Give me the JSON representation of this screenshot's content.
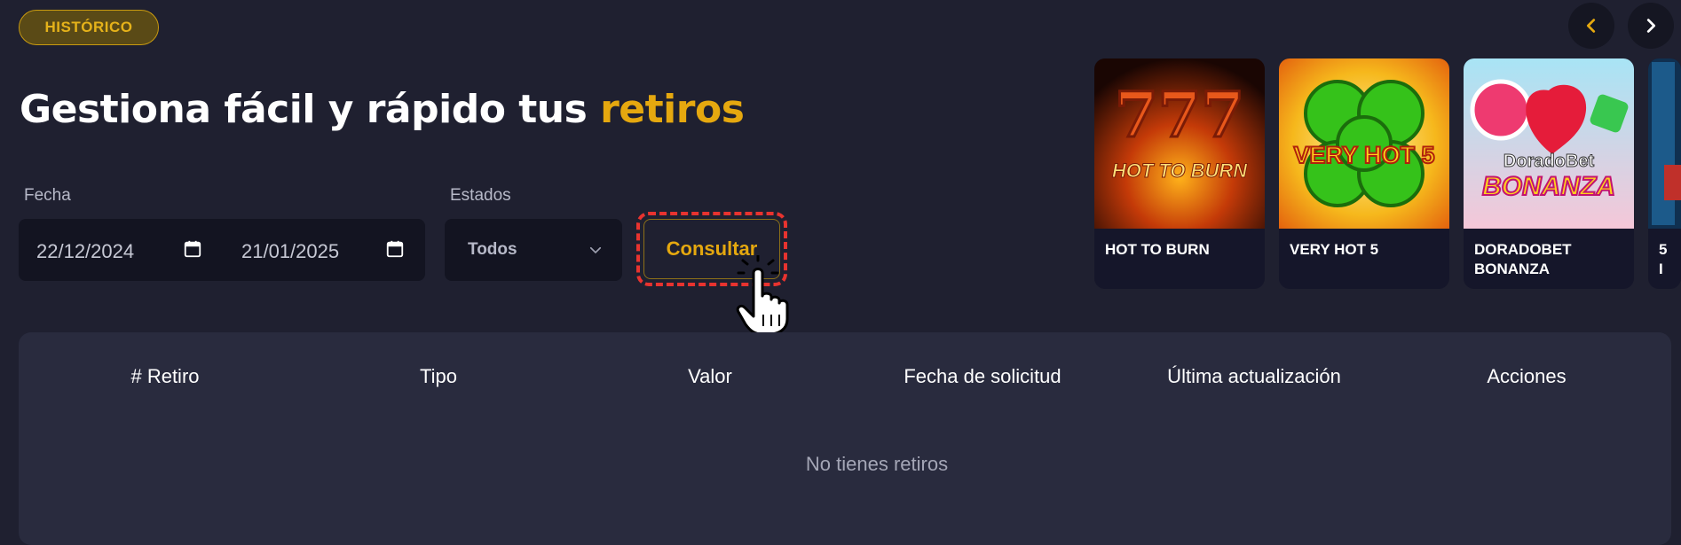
{
  "badge": "HISTÓRICO",
  "heading": {
    "main": "Gestiona fácil y rápido tus ",
    "accent": "retiros"
  },
  "filters": {
    "date_label": "Fecha",
    "date_from": "22/12/2024",
    "date_to": "21/01/2025",
    "status_label": "Estados",
    "status_value": "Todos",
    "submit_label": "Consultar"
  },
  "carousel": {
    "games": [
      {
        "title": "HOT TO BURN",
        "thumb_text": "HOT TO BURN"
      },
      {
        "title": "VERY HOT 5",
        "thumb_text": "VERY HOT 5"
      },
      {
        "title": "DORADOBET BONANZA",
        "thumb_text": "DoradoBet",
        "thumb_text2": "BONANZA"
      },
      {
        "title": "5 I"
      }
    ]
  },
  "table": {
    "columns": [
      "# Retiro",
      "Tipo",
      "Valor",
      "Fecha de solicitud",
      "Última actualización",
      "Acciones"
    ],
    "empty_message": "No tienes retiros"
  },
  "colors": {
    "accent": "#e5a80f",
    "background": "#1f2030",
    "highlight": "#e8332f"
  }
}
